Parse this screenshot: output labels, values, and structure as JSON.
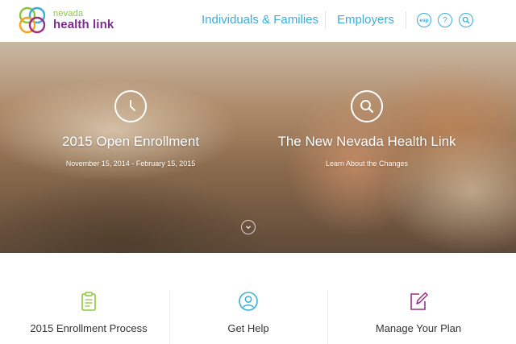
{
  "brand": {
    "small": "nevada",
    "big": "health link",
    "colors": {
      "primary": "#7b2d8e",
      "accent": "#8cc63f",
      "link": "#3aaed8"
    }
  },
  "nav": {
    "individuals": "Individuals & Families",
    "employers": "Employers",
    "esp": "esp",
    "help": "?"
  },
  "hero": {
    "left": {
      "icon": "clock-icon",
      "title": "2015 Open Enrollment",
      "subtitle": "November 15, 2014 - February 15, 2015"
    },
    "right": {
      "icon": "search-icon",
      "title": "The New Nevada Health Link",
      "subtitle": "Learn About the Changes"
    }
  },
  "features": [
    {
      "icon": "clipboard-icon",
      "label": "2015 Enrollment Process",
      "color": "#8cc63f"
    },
    {
      "icon": "person-icon",
      "label": "Get Help",
      "color": "#3aaed8"
    },
    {
      "icon": "edit-icon",
      "label": "Manage Your Plan",
      "color": "#9b2f86"
    }
  ]
}
